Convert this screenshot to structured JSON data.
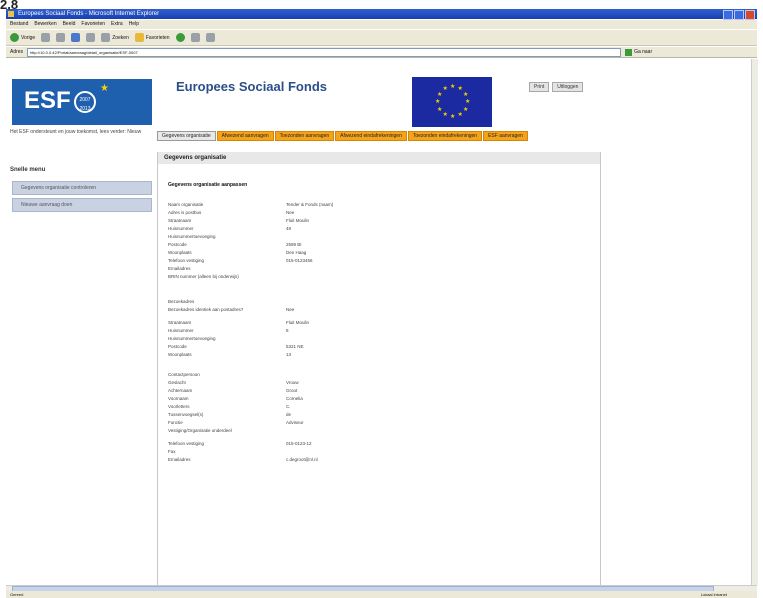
{
  "top_label": "2.8",
  "window": {
    "title": "Europees Sociaal Fonds - Microsoft Internet Explorer"
  },
  "menu": [
    "Bestand",
    "Bewerken",
    "Beeld",
    "Favorieten",
    "Extra",
    "Help"
  ],
  "toolbar": {
    "back": "Vorige",
    "search": "Zoeken",
    "favorites": "Favorieten"
  },
  "address": {
    "label": "Adres",
    "value": "http://10.0.0.42/Portal/aanvraag/detail_organisatie/ESF-0007",
    "go": "Ga naar"
  },
  "sidebar": {
    "logo": "ESF",
    "logo_years": "2007 2013",
    "intro": "Het ESF ondersteunt en jouw toekomst, lees verder: Nieuw",
    "heading": "Snelle menu",
    "items": [
      {
        "label": "Gegevens organisatie controleren"
      },
      {
        "label": "Nieuwe aanvraag doen"
      }
    ]
  },
  "header": {
    "title": "Europees Sociaal Fonds",
    "buttons": [
      {
        "label": "Print"
      },
      {
        "label": "Uitloggen"
      }
    ]
  },
  "tabs": [
    {
      "label": "Gegevens organisatie",
      "active": true
    },
    {
      "label": "Afwezend aanvragen",
      "active": false
    },
    {
      "label": "Toezonden aanvragen",
      "active": false
    },
    {
      "label": "Afwezend eindafrekeningen",
      "active": false
    },
    {
      "label": "Toezonden eindafrekeningen",
      "active": false
    },
    {
      "label": "ESF aanvragen",
      "active": false
    }
  ],
  "content": {
    "heading": "Gegevens organisatie",
    "section": "Gegevens organisatie aanpassen",
    "block1": [
      {
        "k": "Naam organisatie",
        "v": "Tender & Fonds (naam)"
      },
      {
        "k": "Adres is postbus",
        "v": "Nee"
      },
      {
        "k": "Straatnaam",
        "v": "Fluit Moulin"
      },
      {
        "k": "Huisnummer",
        "v": "48"
      },
      {
        "k": "Huisnummertoevoeging",
        "v": ""
      },
      {
        "k": "Postcode",
        "v": "2599 BI"
      },
      {
        "k": "Woonplaats",
        "v": "Den Haag"
      },
      {
        "k": "Telefoon vestiging",
        "v": "015-0123456"
      },
      {
        "k": "Emailadres",
        "v": ""
      },
      {
        "k": "BRIN nummer (alleen bij onderwijs)",
        "v": ""
      }
    ],
    "block2": [
      {
        "k": "Bezoekadres",
        "v": ""
      },
      {
        "k": "Bezoekadres identiek aan postadres?",
        "v": "Nee"
      },
      {
        "k": "Straatnaam",
        "v": "Fluit Moulin"
      },
      {
        "k": "Huisnummer",
        "v": "8"
      },
      {
        "k": "Huisnummertoevoeging",
        "v": ""
      },
      {
        "k": "Postcode",
        "v": "5321 NE"
      },
      {
        "k": "Woonplaats",
        "v": "13"
      }
    ],
    "block3": [
      {
        "k": "Contactpersoon",
        "v": ""
      },
      {
        "k": "Geslacht",
        "v": "Vrouw"
      },
      {
        "k": "Achternaam",
        "v": "Groot"
      },
      {
        "k": "Voornaam",
        "v": "Cornelia"
      },
      {
        "k": "Voorletters",
        "v": "C."
      },
      {
        "k": "Tussenvoegsel(s)",
        "v": "de"
      },
      {
        "k": "Functie",
        "v": "Adviseur"
      },
      {
        "k": "Vestiging/Organisatie onderdeel",
        "v": ""
      },
      {
        "k": "Telefoon vestiging",
        "v": "015-0123-12"
      },
      {
        "k": "Fax",
        "v": ""
      },
      {
        "k": "Emailadres",
        "v": "c.degroot@nl.nl"
      }
    ]
  },
  "status": {
    "text": "Gereed",
    "zone": "Lokaal intranet"
  }
}
